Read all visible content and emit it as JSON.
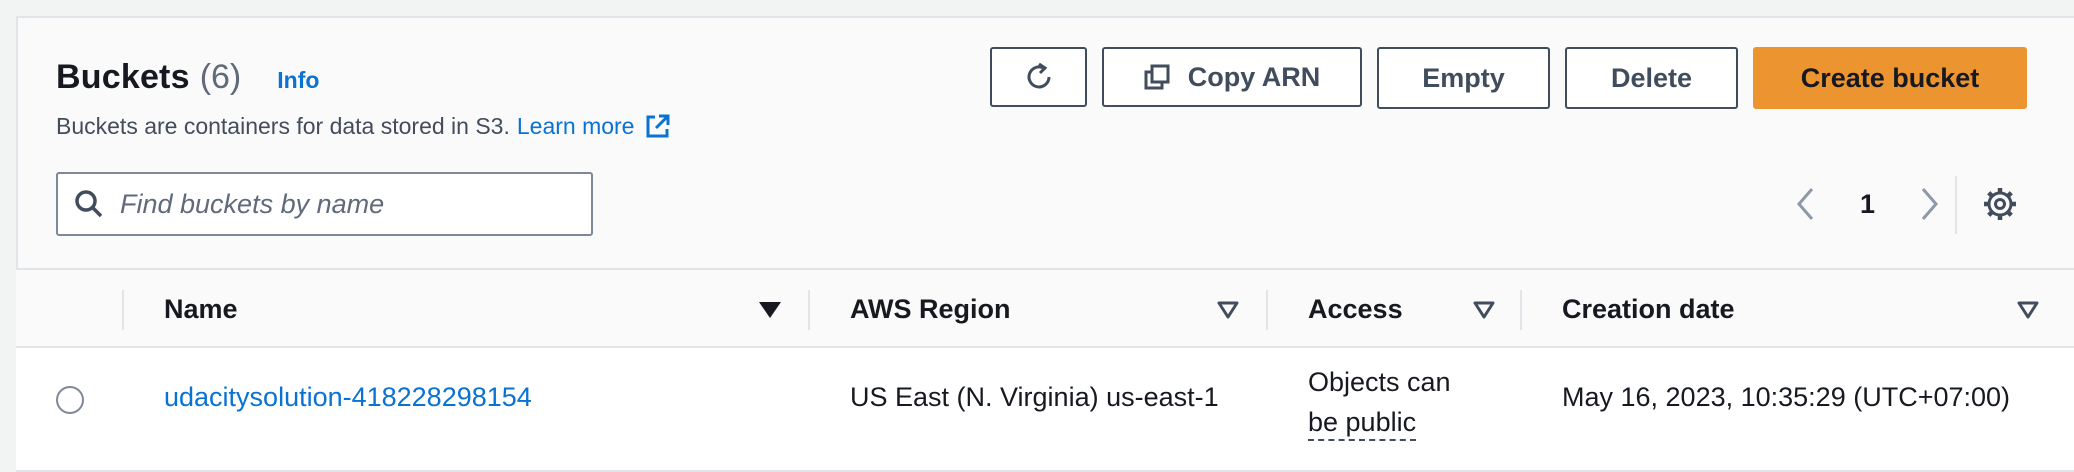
{
  "header": {
    "title": "Buckets",
    "count": "(6)",
    "info_label": "Info",
    "description": "Buckets are containers for data stored in S3.",
    "learn_more": "Learn more"
  },
  "toolbar": {
    "refresh_icon": "refresh-icon",
    "copy_arn_label": "Copy ARN",
    "empty_label": "Empty",
    "delete_label": "Delete",
    "create_label": "Create bucket"
  },
  "search": {
    "placeholder": "Find buckets by name",
    "value": ""
  },
  "pagination": {
    "current_page": "1"
  },
  "table": {
    "columns": [
      "Name",
      "AWS Region",
      "Access",
      "Creation date"
    ],
    "rows": [
      {
        "name": "udacitysolution-418228298154",
        "region": "US East (N. Virginia) us-east-1",
        "access_line1": "Objects can",
        "access_line2": "be public",
        "created": "May 16, 2023, 10:35:29 (UTC+07:00)"
      }
    ]
  },
  "colors": {
    "accent": "#0972d3",
    "primary_button": "#ec9430",
    "text": "#16191f"
  }
}
